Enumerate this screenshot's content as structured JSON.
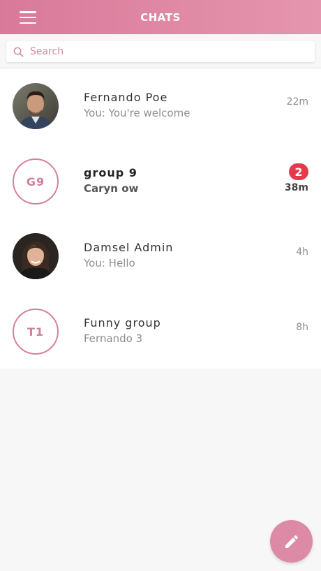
{
  "header": {
    "title": "CHATS",
    "menu_icon": "hamburger-menu-icon"
  },
  "search": {
    "placeholder": "Search",
    "value": "",
    "icon": "search-icon"
  },
  "chats": [
    {
      "name": "Fernando Poe",
      "preview": "You: You're welcome",
      "time": "22m",
      "avatar": "photo",
      "unread": null
    },
    {
      "name": "group 9",
      "preview": "Caryn ow",
      "time": "38m",
      "avatar_initials": "G9",
      "unread": "2"
    },
    {
      "name": "Damsel Admin",
      "preview": "You: Hello",
      "time": "4h",
      "avatar": "photo",
      "unread": null
    },
    {
      "name": "Funny group",
      "preview": "Fernando 3",
      "time": "8h",
      "avatar_initials": "T1",
      "unread": null
    }
  ],
  "fab": {
    "icon": "pencil-icon"
  },
  "colors": {
    "accent": "#d9799a",
    "badge": "#e8394b"
  }
}
